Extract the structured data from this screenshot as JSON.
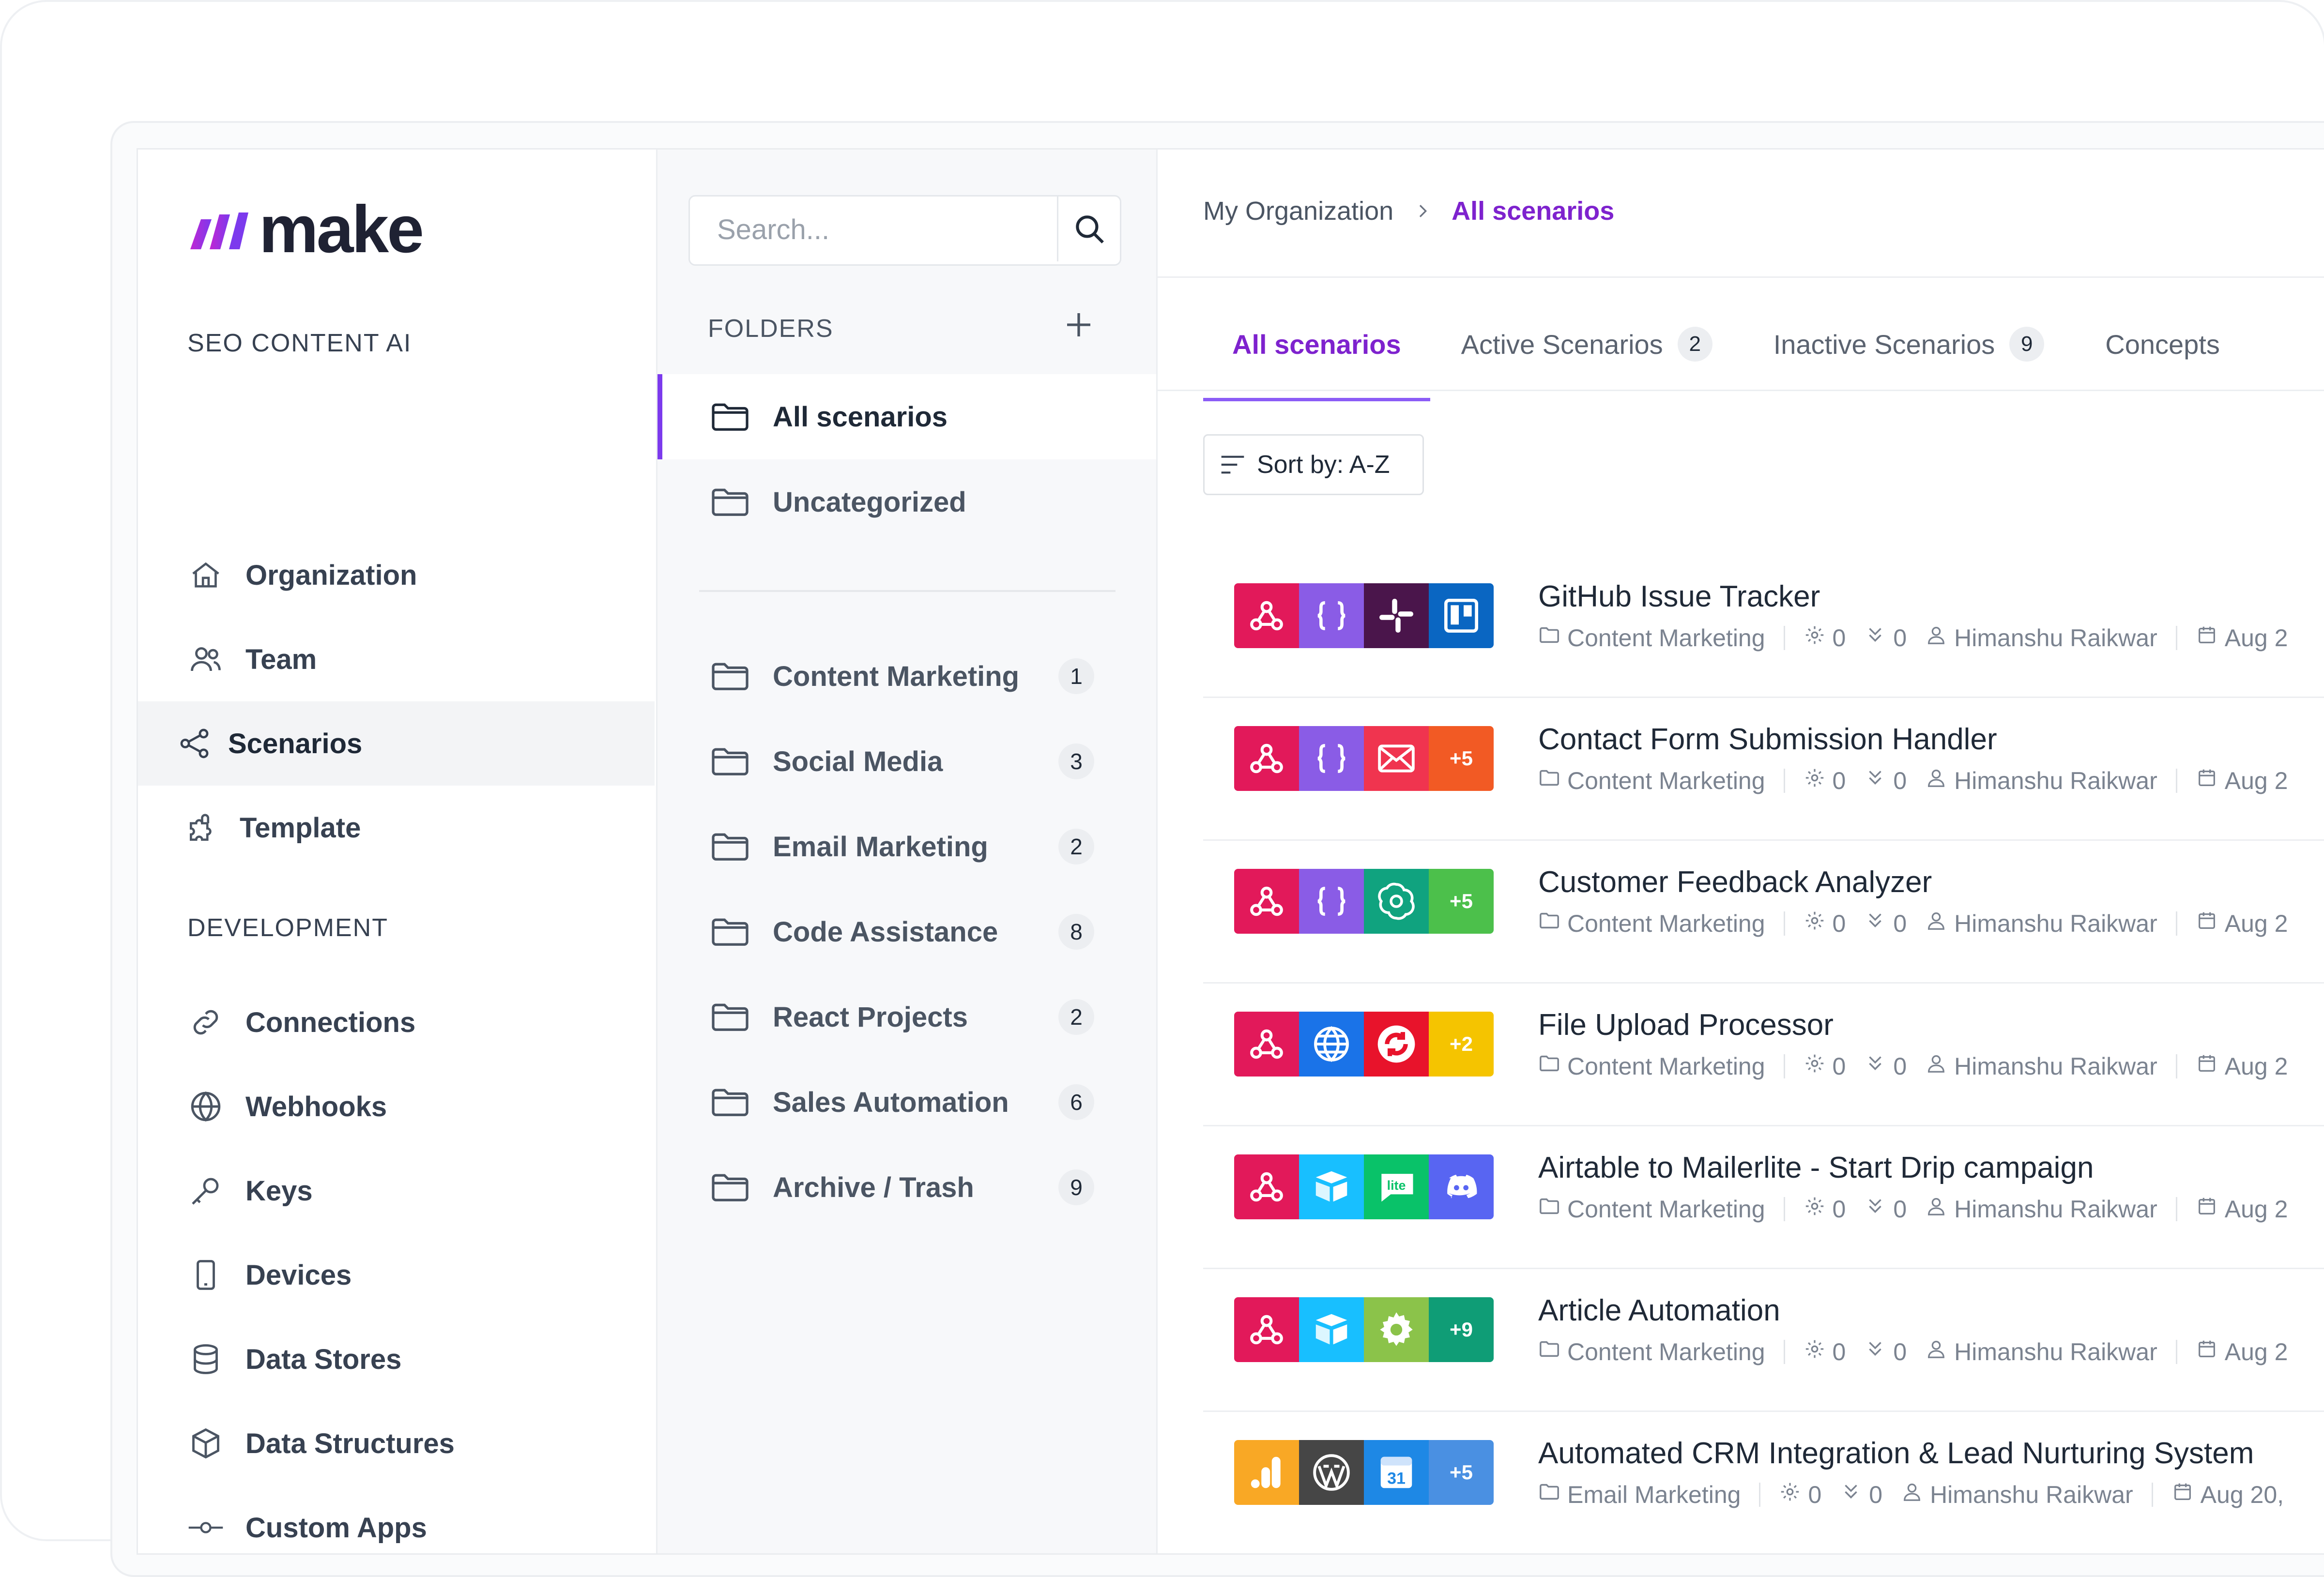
{
  "brand": {
    "name": "make"
  },
  "sidebar": {
    "section1_title": "SEO CONTENT AI",
    "section1_items": [
      {
        "label": "Organization",
        "icon": "home-icon"
      },
      {
        "label": "Team",
        "icon": "users-icon"
      },
      {
        "label": "Scenarios",
        "icon": "share-nodes-icon",
        "active": true
      },
      {
        "label": "Template",
        "icon": "puzzle-icon"
      }
    ],
    "section2_title": "DEVELOPMENT",
    "section2_items": [
      {
        "label": "Connections",
        "icon": "link-icon"
      },
      {
        "label": "Webhooks",
        "icon": "globe-icon"
      },
      {
        "label": "Keys",
        "icon": "key-icon"
      },
      {
        "label": "Devices",
        "icon": "phone-icon"
      },
      {
        "label": "Data Stores",
        "icon": "database-icon"
      },
      {
        "label": "Data Structures",
        "icon": "cube-icon"
      },
      {
        "label": "Custom Apps",
        "icon": "commit-icon"
      }
    ]
  },
  "folders": {
    "search_placeholder": "Search...",
    "heading": "FOLDERS",
    "top_items": [
      {
        "label": "All scenarios",
        "active": true
      },
      {
        "label": "Uncategorized"
      }
    ],
    "items": [
      {
        "label": "Content Marketing",
        "count": "1"
      },
      {
        "label": "Social Media",
        "count": "3"
      },
      {
        "label": "Email Marketing",
        "count": "2"
      },
      {
        "label": "Code Assistance",
        "count": "8"
      },
      {
        "label": "React Projects",
        "count": "2"
      },
      {
        "label": "Sales Automation",
        "count": "6"
      },
      {
        "label": "Archive / Trash",
        "count": "9"
      }
    ]
  },
  "main": {
    "breadcrumb": {
      "org": "My Organization",
      "current": "All scenarios"
    },
    "tabs": [
      {
        "label": "All scenarios",
        "active": true,
        "count": ""
      },
      {
        "label": "Active Scenarios",
        "count": "2"
      },
      {
        "label": "Inactive Scenarios",
        "count": "9"
      },
      {
        "label": "Concepts",
        "count": ""
      }
    ],
    "sort_label": "Sort by: A-Z",
    "scenarios": [
      {
        "title": "GitHub Issue Tracker",
        "folder": "Content Marketing",
        "ops": "0",
        "transfers": "0",
        "owner": "Himanshu Raikwar",
        "date": "Aug 2",
        "apps": [
          {
            "icon": "webhook-icon",
            "color": "#e2195a"
          },
          {
            "icon": "json-icon",
            "color": "#8a5ce6"
          },
          {
            "icon": "slack-icon",
            "color": "#4a154b"
          },
          {
            "icon": "trello-icon",
            "color": "#0a66c2"
          }
        ]
      },
      {
        "title": "Contact Form Submission Handler",
        "folder": "Content Marketing",
        "ops": "0",
        "transfers": "0",
        "owner": "Himanshu Raikwar",
        "date": "Aug 2",
        "apps": [
          {
            "icon": "webhook-icon",
            "color": "#e2195a"
          },
          {
            "icon": "json-icon",
            "color": "#8a5ce6"
          },
          {
            "icon": "email-icon",
            "color": "#f0344f"
          },
          {
            "more": "+5",
            "color": "#f25a24"
          }
        ]
      },
      {
        "title": "Customer Feedback Analyzer",
        "folder": "Content Marketing",
        "ops": "0",
        "transfers": "0",
        "owner": "Himanshu Raikwar",
        "date": "Aug 2",
        "apps": [
          {
            "icon": "webhook-icon",
            "color": "#e2195a"
          },
          {
            "icon": "json-icon",
            "color": "#8a5ce6"
          },
          {
            "icon": "openai-icon",
            "color": "#10a37f"
          },
          {
            "more": "+5",
            "color": "#4cc04b"
          }
        ]
      },
      {
        "title": "File Upload Processor",
        "folder": "Content Marketing",
        "ops": "0",
        "transfers": "0",
        "owner": "Himanshu Raikwar",
        "date": "Aug 2",
        "apps": [
          {
            "icon": "webhook-icon",
            "color": "#e2195a"
          },
          {
            "icon": "globe-icon",
            "color": "#1a73e8"
          },
          {
            "icon": "sync-icon",
            "color": "#e8132b"
          },
          {
            "more": "+2",
            "color": "#f5c400"
          }
        ]
      },
      {
        "title": "Airtable to Mailerlite - Start Drip campaign",
        "folder": "Content Marketing",
        "ops": "0",
        "transfers": "0",
        "owner": "Himanshu Raikwar",
        "date": "Aug 2",
        "apps": [
          {
            "icon": "webhook-icon",
            "color": "#e2195a"
          },
          {
            "icon": "airtable-icon",
            "color": "#18bfff"
          },
          {
            "icon": "mailerlite-icon",
            "color": "#09c269"
          },
          {
            "icon": "discord-icon",
            "color": "#5865f2"
          }
        ]
      },
      {
        "title": "Article Automation",
        "folder": "Content Marketing",
        "ops": "0",
        "transfers": "0",
        "owner": "Himanshu Raikwar",
        "date": "Aug 2",
        "apps": [
          {
            "icon": "webhook-icon",
            "color": "#e2195a"
          },
          {
            "icon": "airtable-icon",
            "color": "#18bfff"
          },
          {
            "icon": "gear-icon",
            "color": "#8bc34a"
          },
          {
            "more": "+9",
            "color": "#0f9d76"
          }
        ]
      },
      {
        "title": "Automated CRM Integration & Lead Nurturing System",
        "folder": "Email Marketing",
        "ops": "0",
        "transfers": "0",
        "owner": "Himanshu Raikwar",
        "date": "Aug 20,",
        "apps": [
          {
            "icon": "analytics-icon",
            "color": "#f9a825"
          },
          {
            "icon": "wordpress-icon",
            "color": "#464646"
          },
          {
            "icon": "calendar-icon",
            "color": "#1e88e5"
          },
          {
            "more": "+5",
            "color": "#4a90e2"
          }
        ]
      }
    ]
  }
}
